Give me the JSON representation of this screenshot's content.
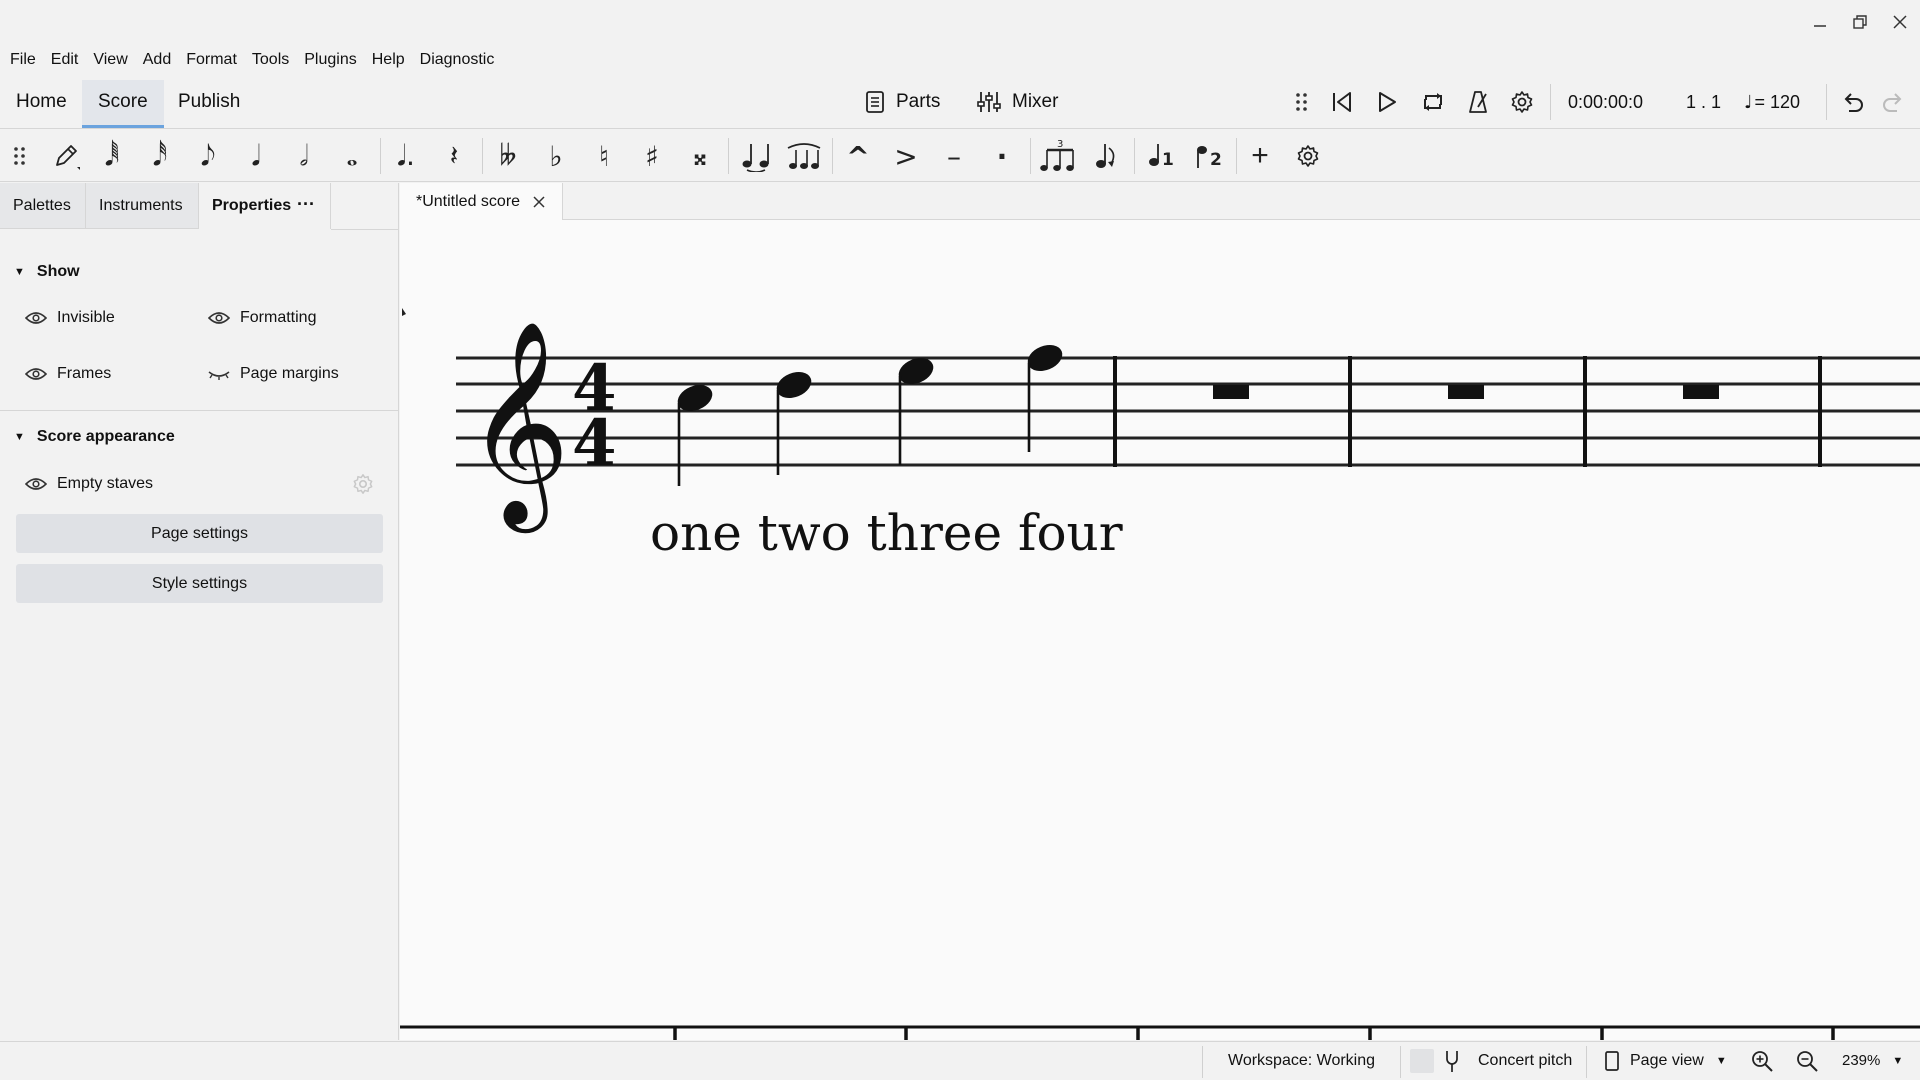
{
  "menu": [
    "File",
    "Edit",
    "View",
    "Add",
    "Format",
    "Tools",
    "Plugins",
    "Help",
    "Diagnostic"
  ],
  "main_tabs": {
    "home": "Home",
    "score": "Score",
    "publish": "Publish"
  },
  "toolbar": {
    "parts": "Parts",
    "mixer": "Mixer",
    "time": "0:00:00:0",
    "position": "1 . 1",
    "tempo": "= 120"
  },
  "note_toolbar": {
    "durations": [
      "𝅘𝅥𝅱",
      "𝅘𝅥𝅰",
      "𝅘𝅥𝅮",
      "𝅘𝅥",
      "𝅗𝅥",
      "𝅝"
    ],
    "dot": "𝅘𝅥.",
    "rest": "𝄽",
    "accidentals": [
      "𝄫",
      "♭",
      "♮",
      "♯",
      "𝄪"
    ],
    "articulations": [
      "^",
      ">",
      "–",
      "·"
    ],
    "tuplet_number": "3",
    "voice1": "1",
    "voice2": "2",
    "add": "+"
  },
  "panel": {
    "tabs": {
      "palettes": "Palettes",
      "instruments": "Instruments",
      "properties": "Properties"
    },
    "more": "···",
    "show": {
      "title": "Show",
      "invisible": "Invisible",
      "formatting": "Formatting",
      "frames": "Frames",
      "page_margins": "Page margins"
    },
    "score_appearance": {
      "title": "Score appearance",
      "empty_staves": "Empty staves",
      "page_settings": "Page settings",
      "style_settings": "Style settings"
    }
  },
  "document": {
    "tab_title": "*Untitled score"
  },
  "score": {
    "time_signature": {
      "top": "4",
      "bottom": "4"
    },
    "lyrics": "one two three four",
    "notes": [
      "C5",
      "D5",
      "E5",
      "F5"
    ],
    "measures": 4
  },
  "status": {
    "workspace": "Workspace: Working",
    "concert_pitch": "Concert pitch",
    "view": "Page view",
    "zoom": "239%"
  },
  "colors": {
    "accent": "#6ba3de",
    "background": "#f2f2f2",
    "canvas": "#fafafa"
  }
}
